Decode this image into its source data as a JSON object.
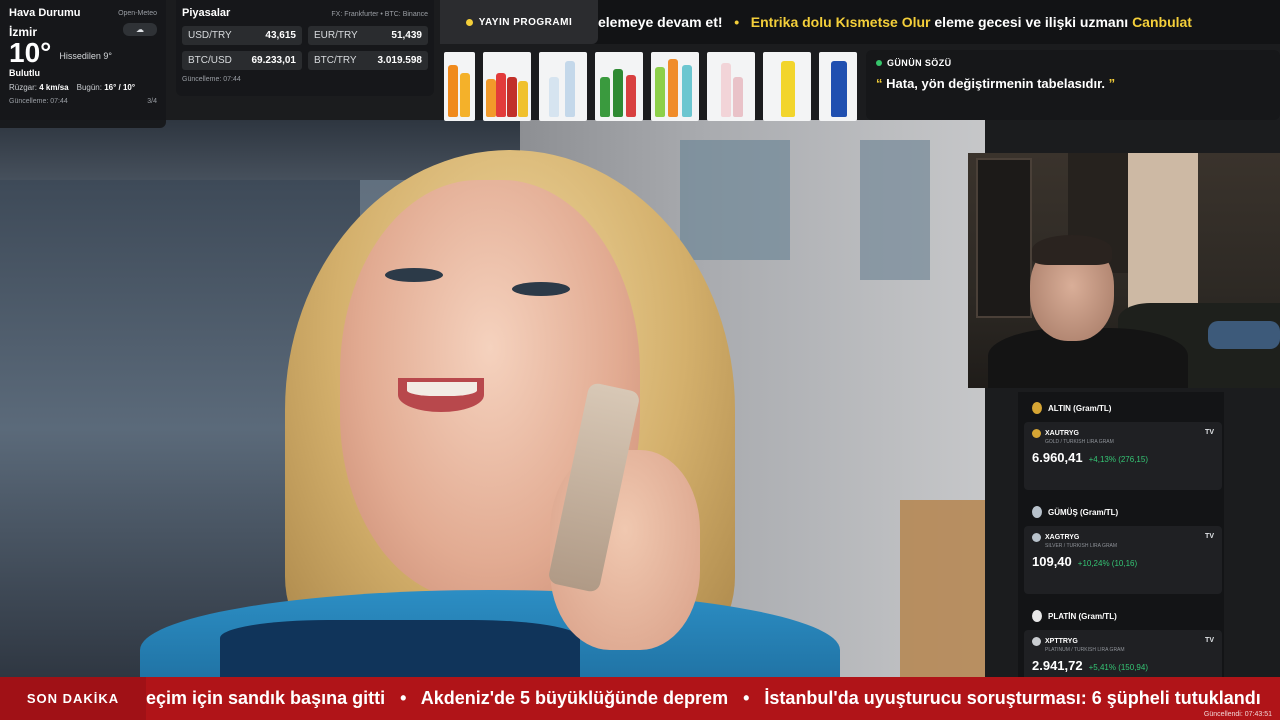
{
  "weather": {
    "title": "Hava Durumu",
    "source": "Open-Meteo",
    "city": "İzmir",
    "icon": "cloud-icon",
    "temperature": "10°",
    "feels_like": "Hissedilen 9°",
    "condition": "Bulutlu",
    "wind_label": "Rüzgar:",
    "wind_value": "4 km/sa",
    "today_label": "Bugün:",
    "today_value": "16° / 10°",
    "updated": "Güncelleme: 07:44",
    "page": "3/4"
  },
  "markets": {
    "title": "Piyasalar",
    "source": "FX: Frankfurter • BTC: Binance",
    "items": [
      {
        "label": "USD/TRY",
        "value": "43,615"
      },
      {
        "label": "EUR/TRY",
        "value": "51,439"
      },
      {
        "label": "BTC/USD",
        "value": "69.233,01"
      },
      {
        "label": "BTC/TRY",
        "value": "3.019.598"
      }
    ],
    "updated": "Güncelleme: 07:44"
  },
  "top_ticker": {
    "tag": "YAYIN PROGRAMI",
    "part1": "elemeye devam et!",
    "sep": "•",
    "part2": "Entrika dolu Kısmetse Olur",
    "part3": "eleme gecesi ve ilişki uzmanı",
    "part4": "Canbulat"
  },
  "products": [
    {
      "name": "orange-soda-bottles"
    },
    {
      "name": "mixed-soda-bottles"
    },
    {
      "name": "water-bottles"
    },
    {
      "name": "green-soda-bottles"
    },
    {
      "name": "flavored-soda-bottles"
    },
    {
      "name": "pink-water-bottles"
    },
    {
      "name": "yellow-lemonade-bottle"
    },
    {
      "name": "energy-drink-can"
    }
  ],
  "quote": {
    "label": "GÜNÜN SÖZÜ",
    "open_mark": "“",
    "text": "Hata, yön değiştirmenin tabelasıdır.",
    "close_mark": "”"
  },
  "metals": [
    {
      "title": "ALTIN (Gram/TL)",
      "symbol": "XAUTRYG",
      "sub": "GOLD / TURKISH LIRA GRAM",
      "price": "6.960,41",
      "change": "+4,13% (276,15)",
      "tv": "TV",
      "color": "#d6a534"
    },
    {
      "title": "GÜMÜŞ (Gram/TL)",
      "symbol": "XAGTRYG",
      "sub": "SILVER / TURKISH LIRA GRAM",
      "price": "109,40",
      "change": "+10,24% (10,16)",
      "tv": "TV",
      "color": "#b8c2cc"
    },
    {
      "title": "PLATİN (Gram/TL)",
      "symbol": "XPTTRYG",
      "sub": "PLATINUM / TURKISH LIRA GRAM",
      "price": "2.941,72",
      "change": "+5,41% (150,94)",
      "tv": "TV",
      "color": "#e8e8e8"
    }
  ],
  "breaking": {
    "tag": "SON DAKİKA",
    "item1": "eçim için sandık başına gitti",
    "item2": "Akdeniz'de 5 büyüklüğünde deprem",
    "item3": "İstanbul'da uyuşturucu soruşturması: 6 şüpheli tutuklandı",
    "sep": "•",
    "updated": "Güncellendi: 07:43:51"
  },
  "colors": {
    "accent_yellow": "#f4cf3a",
    "breaking_red": "#b01418",
    "positive_green": "#35c474"
  }
}
